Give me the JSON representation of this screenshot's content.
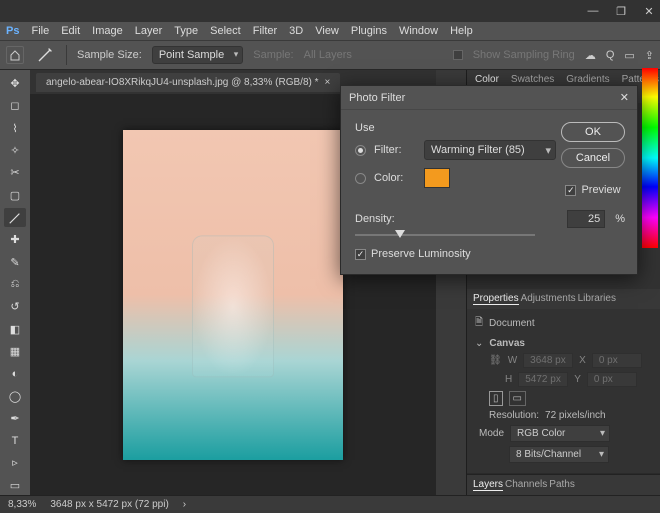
{
  "menu": [
    "File",
    "Edit",
    "Image",
    "Layer",
    "Type",
    "Select",
    "Filter",
    "3D",
    "View",
    "Plugins",
    "Window",
    "Help"
  ],
  "option_bar": {
    "sample_size_label": "Sample Size:",
    "sample_size_value": "Point Sample",
    "sample_label": "Sample:",
    "sample_value": "All Layers",
    "show_ring": "Show Sampling Ring"
  },
  "doc_tab": {
    "title": "angelo-abear-IO8XRikqJU4-unsplash.jpg @ 8,33% (RGB/8) *",
    "close": "×"
  },
  "dialog": {
    "title": "Photo Filter",
    "use_label": "Use",
    "filter_label": "Filter:",
    "filter_value": "Warming Filter (85)",
    "color_label": "Color:",
    "ok": "OK",
    "cancel": "Cancel",
    "preview": "Preview",
    "density_label": "Density:",
    "density_value": "25",
    "density_unit": "%",
    "preserve": "Preserve Luminosity"
  },
  "color_panel_tabs": [
    "Color",
    "Swatches",
    "Gradients",
    "Patterns"
  ],
  "properties": {
    "tabs": [
      "Properties",
      "Adjustments",
      "Libraries"
    ],
    "document_label": "Document",
    "canvas_label": "Canvas",
    "w_label": "W",
    "w_val": "3648 px",
    "x_label": "X",
    "x_val": "0 px",
    "h_label": "H",
    "h_val": "5472 px",
    "y_label": "Y",
    "y_val": "0 px",
    "res_label": "Resolution:",
    "res_val": "72 pixels/inch",
    "mode_label": "Mode",
    "mode_val": "RGB Color",
    "bits_val": "8 Bits/Channel"
  },
  "layers_tabs": [
    "Layers",
    "Channels",
    "Paths"
  ],
  "status": {
    "zoom": "8,33%",
    "dims": "3648 px x 5472 px (72 ppi)"
  }
}
